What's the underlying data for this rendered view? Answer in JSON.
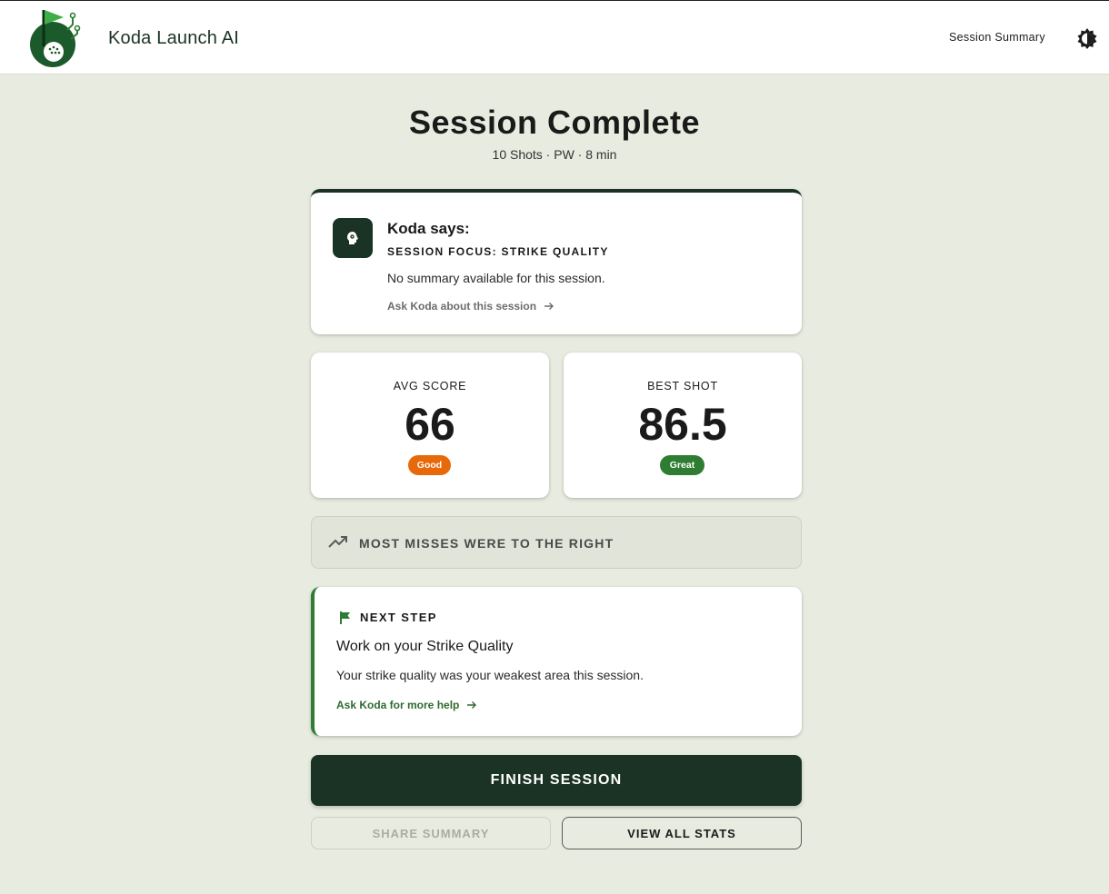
{
  "header": {
    "app_title": "Koda Launch AI",
    "nav_link": "Session Summary",
    "logo_icon": "golf-ball-flag-logo",
    "theme_icon": "brightness-toggle-icon"
  },
  "main": {
    "title": "Session Complete",
    "subtitle": "10 Shots · PW · 8 min"
  },
  "koda_card": {
    "heading": "Koda says:",
    "focus": "SESSION FOCUS: STRIKE QUALITY",
    "summary": "No summary available for this session.",
    "ask_link": "Ask Koda about this session",
    "avatar_icon": "coach-head-icon"
  },
  "stats": {
    "avg": {
      "label": "AVG SCORE",
      "value": "66",
      "badge": "Good",
      "badge_color": "#e8690a"
    },
    "best": {
      "label": "BEST SHOT",
      "value": "86.5",
      "badge": "Great",
      "badge_color": "#2e7d32"
    }
  },
  "miss": {
    "text": "MOST MISSES WERE TO THE RIGHT",
    "icon": "trending-up-icon"
  },
  "next_step": {
    "label": "NEXT STEP",
    "title": "Work on your Strike Quality",
    "description": "Your strike quality was your weakest area this session.",
    "help_link": "Ask Koda for more help",
    "icon": "flag-icon"
  },
  "actions": {
    "finish": "FINISH SESSION",
    "share": "SHARE SUMMARY",
    "view_stats": "VIEW ALL STATS"
  },
  "colors": {
    "brand_dark": "#1b3324",
    "accent_green": "#2e7d32",
    "accent_orange": "#e8690a",
    "page_bg": "#e8ebdf"
  }
}
